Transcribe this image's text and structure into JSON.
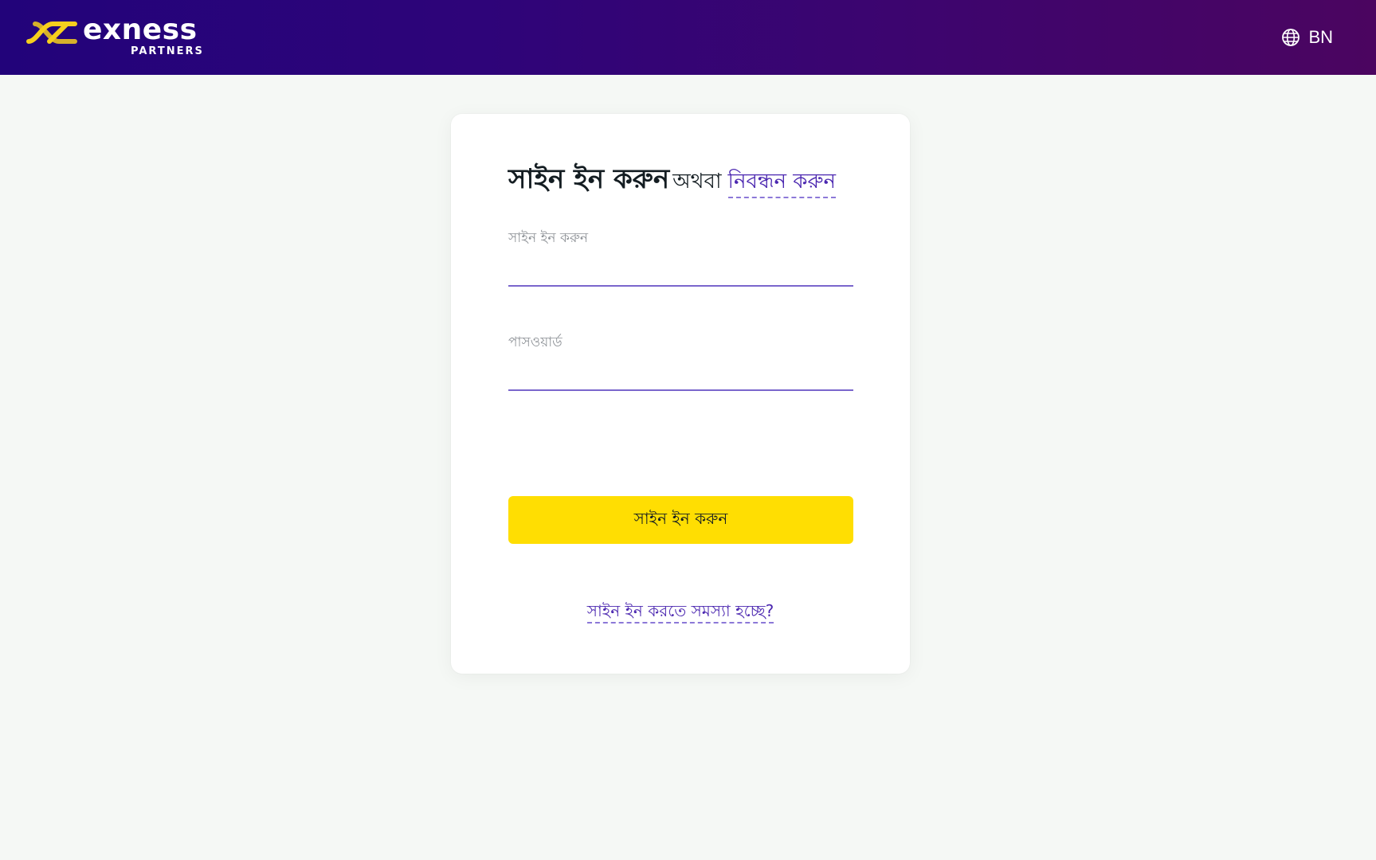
{
  "header": {
    "brand_name": "exness",
    "brand_sub": "PARTNERS",
    "language_code": "BN",
    "language_icon": "globe-icon",
    "logo_colors": {
      "mark": "#f6cf1d",
      "text": "#ffffff"
    },
    "gradient_colors": [
      "#22037a",
      "#4b0560"
    ]
  },
  "signin": {
    "title": "সাইন ইন করুন",
    "or_text": "অথবা",
    "register_link": "নিবন্ধন করুন",
    "login_label": "সাইন ইন করুন",
    "login_value": "",
    "password_label": "পাসওয়ার্ড",
    "password_value": "",
    "submit_label": "সাইন ইন করুন",
    "trouble_link": "সাইন ইন করতে সমস্যা হচ্ছে?"
  },
  "colors": {
    "page_background": "#f5f8f5",
    "accent_link": "#4b27b0",
    "button": "#ffde02",
    "input_underline": "#7a66cc"
  }
}
